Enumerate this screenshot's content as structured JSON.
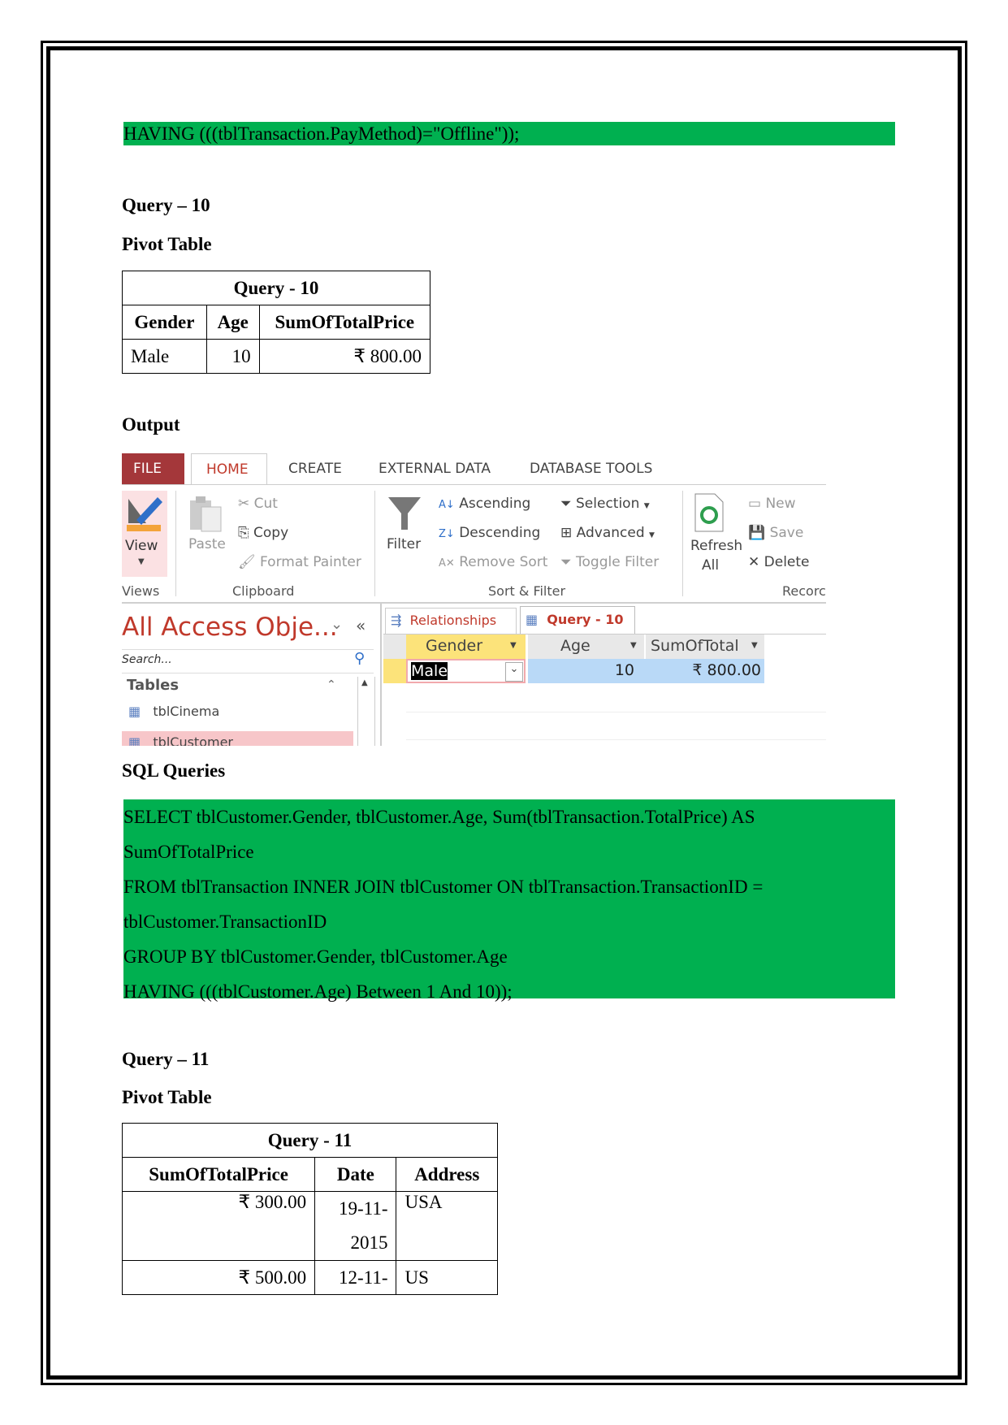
{
  "top_sql": "HAVING (((tblTransaction.PayMethod)=\"Offline\"));",
  "q10": {
    "heading": "Query – 10",
    "pivot_label": "Pivot Table",
    "table": {
      "title": "Query - 10",
      "headers": [
        "Gender",
        "Age",
        "SumOfTotalPrice"
      ],
      "rows": [
        [
          "Male",
          "10",
          "₹ 800.00"
        ]
      ]
    },
    "output_label": "Output",
    "sql_label": "SQL Queries",
    "sql_lines": [
      "SELECT tblCustomer.Gender, tblCustomer.Age, Sum(tblTransaction.TotalPrice) AS",
      "SumOfTotalPrice",
      "FROM tblTransaction INNER JOIN tblCustomer ON tblTransaction.TransactionID =",
      "tblCustomer.TransactionID",
      "GROUP BY tblCustomer.Gender, tblCustomer.Age",
      "HAVING (((tblCustomer.Age) Between 1 And 10));"
    ]
  },
  "access": {
    "tabs": [
      "FILE",
      "HOME",
      "CREATE",
      "EXTERNAL DATA",
      "DATABASE TOOLS"
    ],
    "view": "View",
    "paste": "Paste",
    "cut": "Cut",
    "copy": "Copy",
    "format_painter": "Format Painter",
    "filter": "Filter",
    "ascending": "Ascending",
    "descending": "Descending",
    "remove_sort": "Remove Sort",
    "selection": "Selection",
    "advanced": "Advanced",
    "toggle_filter": "Toggle Filter",
    "refresh": "Refresh",
    "refresh_all": "All",
    "new": "New",
    "save": "Save",
    "delete": "Delete",
    "groups": [
      "Views",
      "Clipboard",
      "Sort & Filter",
      "Recorc"
    ],
    "nav_title": "All Access Obje...",
    "search_placeholder": "Search...",
    "tables_label": "Tables",
    "tables": [
      "tblCinema",
      "tblCustomer"
    ],
    "doc_tabs": [
      "Relationships",
      "Query - 10"
    ],
    "columns": [
      "Gender",
      "Age",
      "SumOfTotal"
    ],
    "row": [
      "Male",
      "10",
      "₹ 800.00"
    ],
    "colors": {
      "file": "#a4373a",
      "accent": "#c0392b",
      "gender_col": "#fce37a",
      "selected": "#b9d9f7"
    }
  },
  "q11": {
    "heading": "Query – 11",
    "pivot_label": "Pivot Table",
    "table": {
      "title": "Query - 11",
      "headers": [
        "SumOfTotalPrice",
        "Date",
        "Address"
      ],
      "rows": [
        [
          "₹ 300.00",
          "19-11-",
          "2015",
          "USA"
        ],
        [
          "₹ 500.00",
          "12-11-",
          "",
          "US"
        ]
      ]
    }
  }
}
